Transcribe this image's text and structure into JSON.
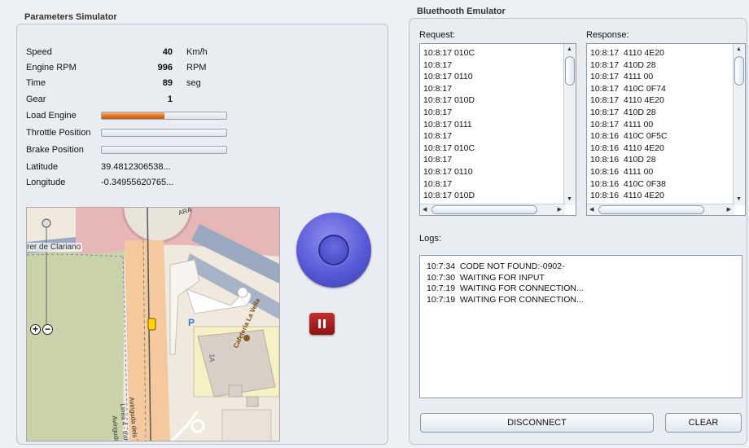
{
  "params_panel": {
    "title": "Parameters Simulator",
    "speed": {
      "label": "Speed",
      "value": "40",
      "unit": "Km/h"
    },
    "rpm": {
      "label": "Engine RPM",
      "value": "996",
      "unit": "RPM"
    },
    "time": {
      "label": "Time",
      "value": "89",
      "unit": "seg"
    },
    "gear": {
      "label": "Gear",
      "value": "1"
    },
    "load_engine": {
      "label": "Load Engine",
      "level": 0.5
    },
    "throttle": {
      "label": "Throttle Position",
      "level": 0
    },
    "brake": {
      "label": "Brake Position",
      "level": 0
    },
    "latitude": {
      "label": "Latitude",
      "value": "39.4812306538..."
    },
    "longitude": {
      "label": "Longitude",
      "value": "-0.34955620765..."
    }
  },
  "map": {
    "street_label_1": "rer de Clariano",
    "street_label_2": "Avinguda dels Tarr",
    "street_label_3": "Línea 4 - tranvía",
    "street_label_4": "Avinguda de",
    "street_label_5": "Cafetería La Vella",
    "street_label_6": "1A",
    "street_label_7": "ARA",
    "zoom_in": "+",
    "zoom_out": "−",
    "colors": {
      "ring_road": "#e7b7b7",
      "green_area": "#c9d2a8",
      "road_orange": "#f5c99e",
      "building": "#d8d0c6"
    }
  },
  "bt_panel": {
    "title": "Bluethooth Emulator",
    "request_label": "Request:",
    "response_label": "Response:",
    "requests": [
      "10:8:17 010C",
      "10:8:17",
      "10:8:17 0110",
      "10:8:17",
      "10:8:17 010D",
      "10:8:17",
      "10:8:17 0111",
      "10:8:17",
      "10:8:17 010C",
      "10:8:17",
      "10:8:17 0110",
      "10:8:17",
      "10:8:17 010D"
    ],
    "responses": [
      "10:8:17  4110 4E20",
      "10:8:17  410D 28",
      "10:8:17  4111 00",
      "10:8:17  410C 0F74",
      "10:8:17  4110 4E20",
      "10:8:17  410D 28",
      "10:8:17  4111 00",
      "10:8:16  410C 0F5C",
      "10:8:16  4110 4E20",
      "10:8:16  410D 28",
      "10:8:16  4111 00",
      "10:8:16  410C 0F38",
      "10:8:16  4110 4E20"
    ],
    "logs_label": "Logs:",
    "logs": [
      "10:7:34  CODE NOT FOUND:-0902-",
      "10:7:30  WAITING FOR INPUT",
      "10:7:19  WAITING FOR CONNECTION...",
      "10:7:19  WAITING FOR CONNECTION..."
    ],
    "disconnect_label": "DISCONNECT",
    "clear_label": "CLEAR"
  },
  "icons": {
    "joystick": "joystick-icon",
    "pause": "pause-icon"
  },
  "colors": {
    "accent_orange": "#d9701f",
    "joystick_blue": "#5a5ad8",
    "pause_red": "#a61d1d"
  }
}
